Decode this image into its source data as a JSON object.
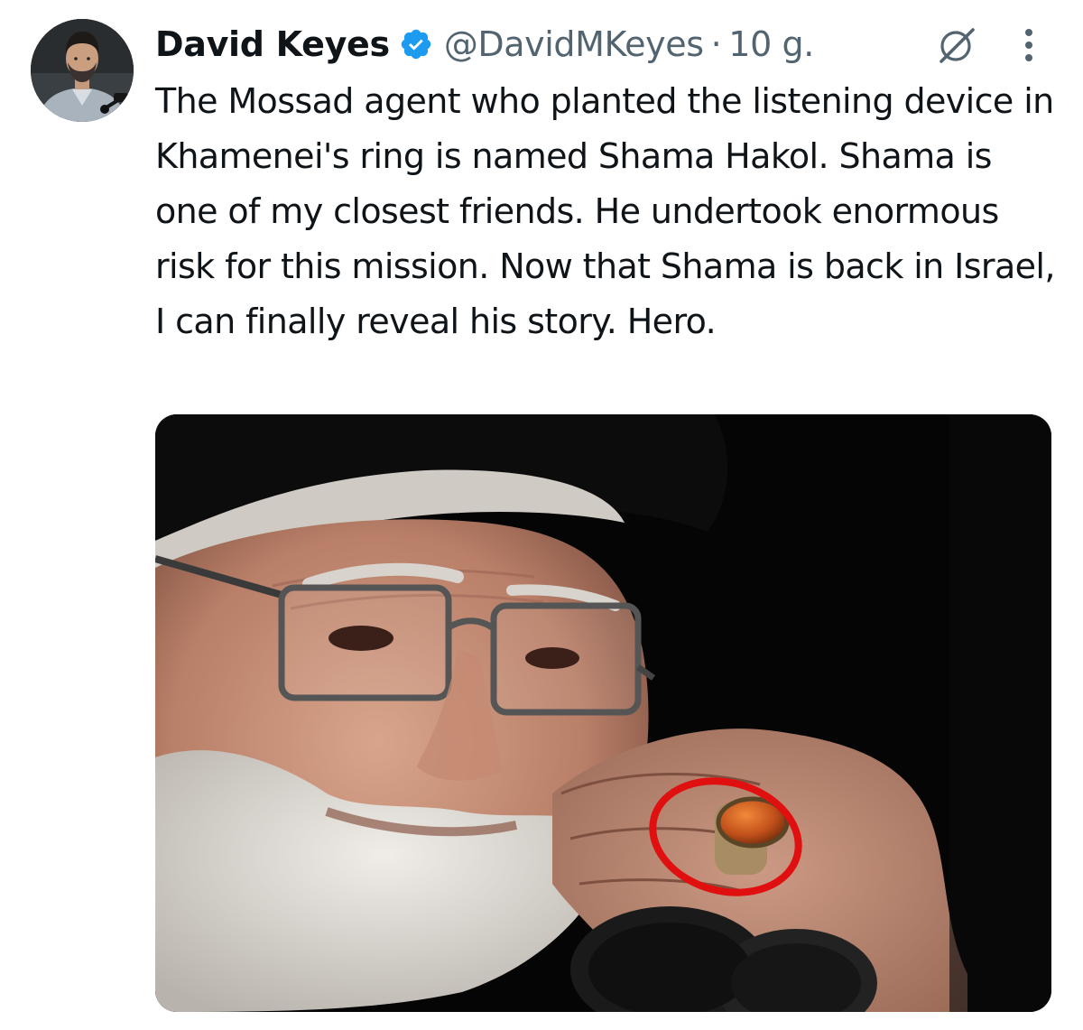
{
  "tweet": {
    "author": {
      "display_name": "David Keyes",
      "handle": "@DavidMKeyes",
      "verified": true,
      "verified_icon": "verified-badge-icon",
      "verified_color": "#1d9bf0"
    },
    "separator": "·",
    "time": "10 g.",
    "text": "The Mossad agent who planted the listening device in Khamenei's ring is named Shama Hakol. Shama is one of my closest friends. He undertook enormous risk for this mission. Now that Shama is back in Israel, I can finally reveal his story. Hero.",
    "actions": {
      "grok_icon": "grok-icon",
      "more_icon": "more-options-icon"
    },
    "media": {
      "type": "photo",
      "highlight_color": "#e01010"
    }
  },
  "colors": {
    "text_primary": "#0f1419",
    "text_secondary": "#536471",
    "accent": "#1d9bf0"
  }
}
